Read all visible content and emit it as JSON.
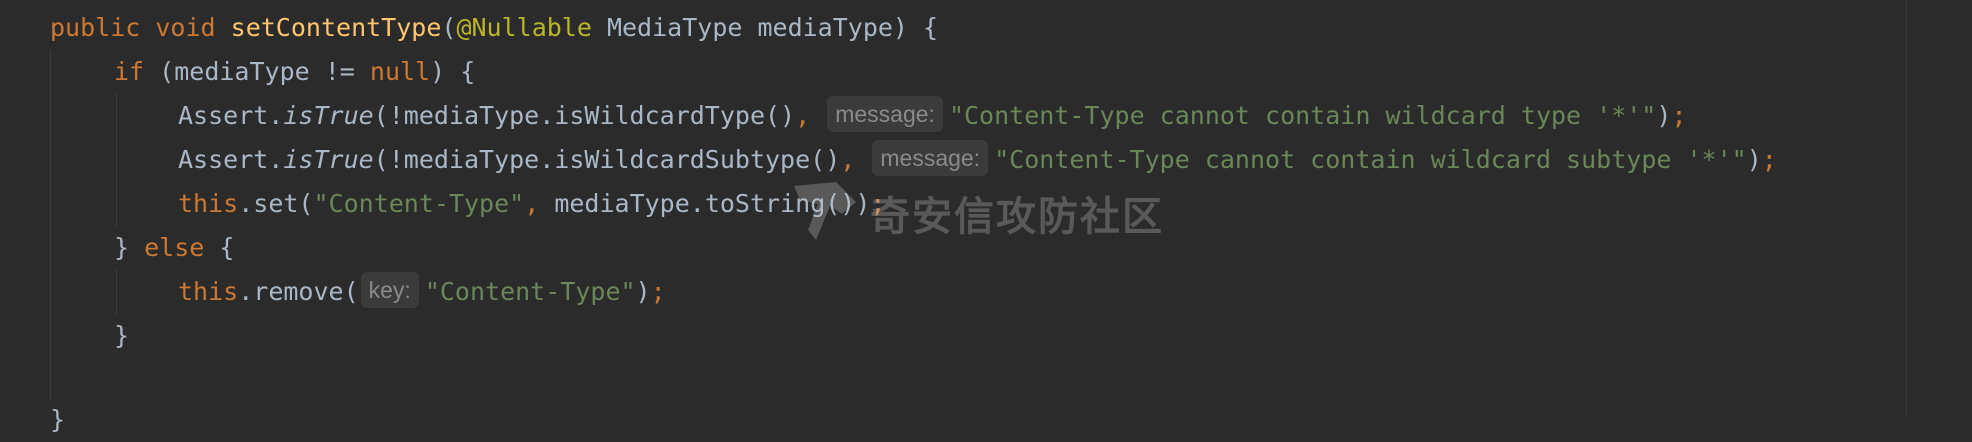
{
  "code": {
    "line1": {
      "kw_public": "public",
      "kw_void": "void",
      "method": "setContentType",
      "paren_open": "(",
      "annotation": "@Nullable",
      "param": " MediaType mediaType) {"
    },
    "line2": {
      "kw_if": "if",
      "cond_a": " (mediaType != ",
      "kw_null": "null",
      "cond_b": ") {"
    },
    "line3": {
      "cls": "Assert.",
      "method": "isTrue",
      "args": "(!mediaType.isWildcardType()",
      "comma": ",",
      "hint": "message:",
      "str": "\"Content-Type cannot contain wildcard type '*'\"",
      "end_paren": ")",
      "semi": ";"
    },
    "line4": {
      "cls": "Assert.",
      "method": "isTrue",
      "args": "(!mediaType.isWildcardSubtype()",
      "comma": ",",
      "hint": "message:",
      "str": "\"Content-Type cannot contain wildcard subtype '*'\"",
      "end_paren": ")",
      "semi": ";"
    },
    "line5": {
      "kw_this": "this",
      "call": ".set(",
      "str": "\"Content-Type\"",
      "comma": ",",
      "rest": " mediaType.toString())",
      "semi": ";"
    },
    "line6": {
      "brace": "} ",
      "kw_else": "else",
      "open": " {"
    },
    "line7": {
      "kw_this": "this",
      "call": ".remove(",
      "hint": "key:",
      "str": "\"Content-Type\"",
      "end_paren": ")",
      "semi": ";"
    },
    "line8": {
      "brace": "}"
    },
    "line10": {
      "brace": "}"
    }
  },
  "watermark": {
    "text": "奇安信攻防社区",
    "icon": "qianxin-logo-icon"
  },
  "colors": {
    "background": "#2b2b2b",
    "keyword": "#cc7832",
    "method_decl": "#ffc66d",
    "annotation": "#bbb529",
    "string": "#6a8759",
    "identifier": "#a9b7c6",
    "hint_bg": "#3b3b3b",
    "hint_fg": "#8a8a8a"
  }
}
